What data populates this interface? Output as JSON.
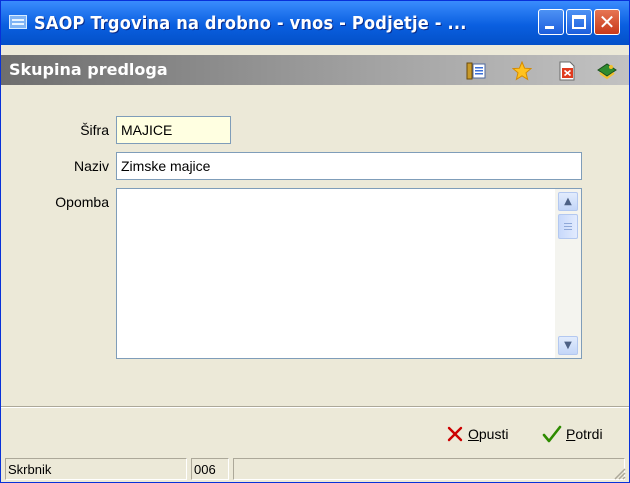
{
  "window": {
    "title": "SAOP Trgovina na drobno - vnos - Podjetje - ..."
  },
  "panel": {
    "title": "Skupina predloga"
  },
  "toolbar": {
    "icons": [
      "list-icon",
      "favorite-star-icon",
      "delete-document-icon",
      "book-icon"
    ]
  },
  "form": {
    "sifra": {
      "label": "Šifra",
      "value": "MAJICE"
    },
    "naziv": {
      "label": "Naziv",
      "value": "Zimske majice"
    },
    "opomba": {
      "label": "Opomba",
      "value": ""
    }
  },
  "buttons": {
    "cancel": {
      "label_accel": "O",
      "label_rest": "pusti"
    },
    "confirm": {
      "label_accel": "P",
      "label_rest": "otrdi"
    }
  },
  "statusbar": {
    "user": "Skrbnik",
    "code": "006",
    "extra": ""
  },
  "colors": {
    "title_blue": "#0a5fe0",
    "highlight_field": "#ffffe1",
    "accent_red": "#cc0000",
    "accent_green": "#2e8b00"
  }
}
